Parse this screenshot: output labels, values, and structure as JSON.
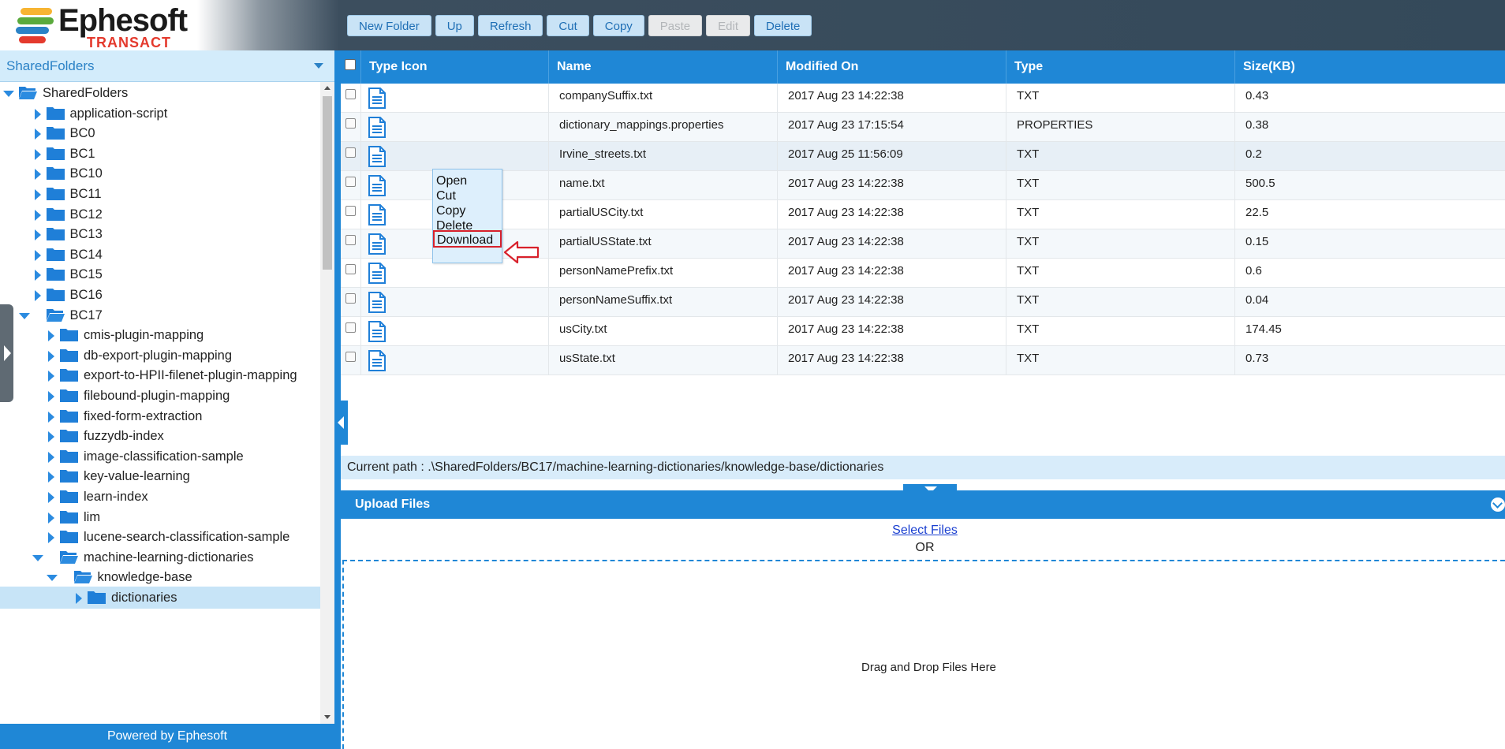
{
  "brand": {
    "name": "Ephesoft",
    "product": "TRANSACT",
    "colors": [
      "#f7b432",
      "#5aaa3c",
      "#2b82c6",
      "#e43a2d"
    ]
  },
  "toolbar": [
    {
      "label": "New Folder",
      "enabled": true
    },
    {
      "label": "Up",
      "enabled": true
    },
    {
      "label": "Refresh",
      "enabled": true
    },
    {
      "label": "Cut",
      "enabled": true
    },
    {
      "label": "Copy",
      "enabled": true
    },
    {
      "label": "Paste",
      "enabled": false
    },
    {
      "label": "Edit",
      "enabled": false
    },
    {
      "label": "Delete",
      "enabled": true
    }
  ],
  "tree": {
    "selector_value": "SharedFolders",
    "nodes": [
      {
        "label": "SharedFolders",
        "depth": 0,
        "expanded": true,
        "selected": false
      },
      {
        "label": "application-script",
        "depth": 1,
        "expanded": false,
        "selected": false
      },
      {
        "label": "BC0",
        "depth": 1,
        "expanded": false,
        "selected": false
      },
      {
        "label": "BC1",
        "depth": 1,
        "expanded": false,
        "selected": false
      },
      {
        "label": "BC10",
        "depth": 1,
        "expanded": false,
        "selected": false
      },
      {
        "label": "BC11",
        "depth": 1,
        "expanded": false,
        "selected": false
      },
      {
        "label": "BC12",
        "depth": 1,
        "expanded": false,
        "selected": false
      },
      {
        "label": "BC13",
        "depth": 1,
        "expanded": false,
        "selected": false
      },
      {
        "label": "BC14",
        "depth": 1,
        "expanded": false,
        "selected": false
      },
      {
        "label": "BC15",
        "depth": 1,
        "expanded": false,
        "selected": false
      },
      {
        "label": "BC16",
        "depth": 1,
        "expanded": false,
        "selected": false
      },
      {
        "label": "BC17",
        "depth": 1,
        "expanded": true,
        "selected": false
      },
      {
        "label": "cmis-plugin-mapping",
        "depth": 2,
        "expanded": false,
        "selected": false
      },
      {
        "label": "db-export-plugin-mapping",
        "depth": 2,
        "expanded": false,
        "selected": false
      },
      {
        "label": "export-to-HPII-filenet-plugin-mapping",
        "depth": 2,
        "expanded": false,
        "selected": false
      },
      {
        "label": "filebound-plugin-mapping",
        "depth": 2,
        "expanded": false,
        "selected": false
      },
      {
        "label": "fixed-form-extraction",
        "depth": 2,
        "expanded": false,
        "selected": false
      },
      {
        "label": "fuzzydb-index",
        "depth": 2,
        "expanded": false,
        "selected": false
      },
      {
        "label": "image-classification-sample",
        "depth": 2,
        "expanded": false,
        "selected": false
      },
      {
        "label": "key-value-learning",
        "depth": 2,
        "expanded": false,
        "selected": false
      },
      {
        "label": "learn-index",
        "depth": 2,
        "expanded": false,
        "selected": false
      },
      {
        "label": "lim",
        "depth": 2,
        "expanded": false,
        "selected": false
      },
      {
        "label": "lucene-search-classification-sample",
        "depth": 2,
        "expanded": false,
        "selected": false
      },
      {
        "label": "machine-learning-dictionaries",
        "depth": 2,
        "expanded": true,
        "selected": false
      },
      {
        "label": "knowledge-base",
        "depth": 3,
        "expanded": true,
        "selected": false
      },
      {
        "label": "dictionaries",
        "depth": 4,
        "expanded": false,
        "selected": true
      }
    ],
    "footer": "Powered by Ephesoft"
  },
  "grid": {
    "headers": [
      "Type Icon",
      "Name",
      "Modified On",
      "Type",
      "Size(KB)"
    ],
    "rows": [
      {
        "name": "companySuffix.txt",
        "modified": "2017 Aug 23 14:22:38",
        "type": "TXT",
        "size": "0.43"
      },
      {
        "name": "dictionary_mappings.properties",
        "modified": "2017 Aug 23 17:15:54",
        "type": "PROPERTIES",
        "size": "0.38"
      },
      {
        "name": "Irvine_streets.txt",
        "modified": "2017 Aug 25 11:56:09",
        "type": "TXT",
        "size": "0.2"
      },
      {
        "name": "name.txt",
        "modified": "2017 Aug 23 14:22:38",
        "type": "TXT",
        "size": "500.5"
      },
      {
        "name": "partialUSCity.txt",
        "modified": "2017 Aug 23 14:22:38",
        "type": "TXT",
        "size": "22.5"
      },
      {
        "name": "partialUSState.txt",
        "modified": "2017 Aug 23 14:22:38",
        "type": "TXT",
        "size": "0.15"
      },
      {
        "name": "personNamePrefix.txt",
        "modified": "2017 Aug 23 14:22:38",
        "type": "TXT",
        "size": "0.6"
      },
      {
        "name": "personNameSuffix.txt",
        "modified": "2017 Aug 23 14:22:38",
        "type": "TXT",
        "size": "0.04"
      },
      {
        "name": "usCity.txt",
        "modified": "2017 Aug 23 14:22:38",
        "type": "TXT",
        "size": "174.45"
      },
      {
        "name": "usState.txt",
        "modified": "2017 Aug 23 14:22:38",
        "type": "TXT",
        "size": "0.73"
      }
    ],
    "highlighted_row": 2
  },
  "current_path": "Current path : .\\SharedFolders/BC17/machine-learning-dictionaries/knowledge-base/dictionaries",
  "upload": {
    "title": "Upload Files",
    "select_files": "Select Files",
    "or": "OR",
    "drop_text": "Drag and Drop Files Here"
  },
  "context_menu": {
    "items": [
      "Open",
      "Cut",
      "Copy",
      "Delete",
      "Download"
    ],
    "highlighted": "Download",
    "annotation_color": "#d8212b"
  }
}
